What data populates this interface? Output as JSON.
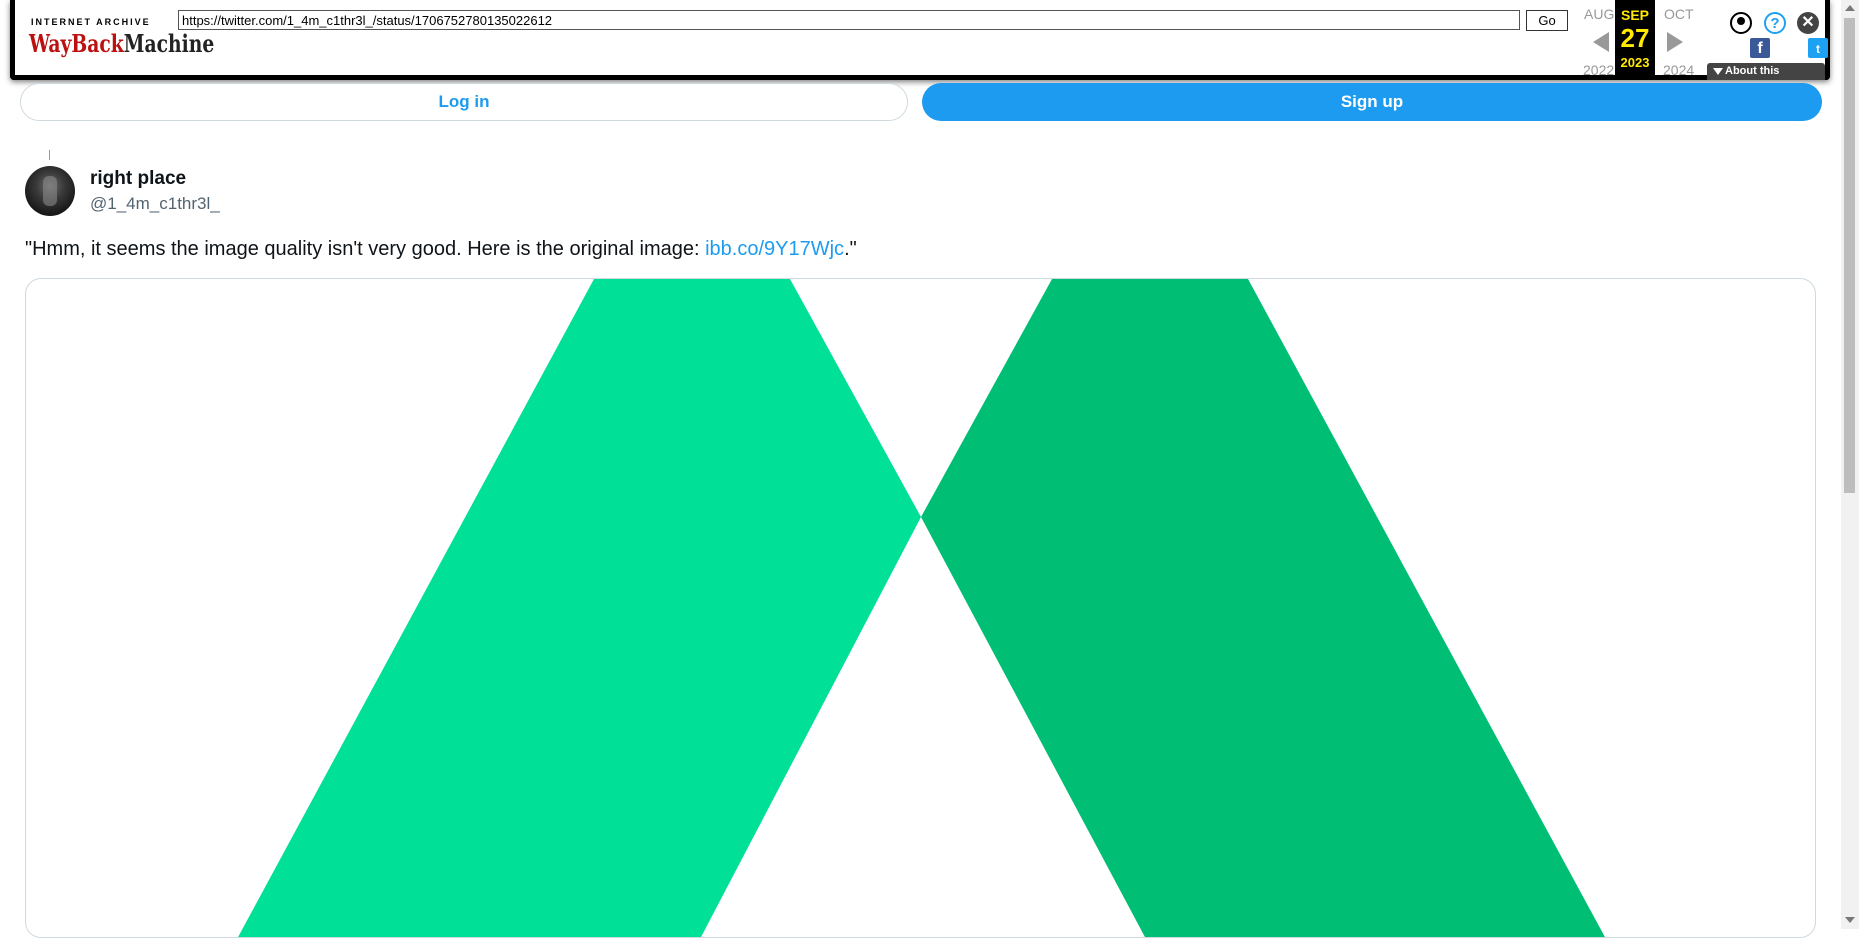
{
  "wayback": {
    "logo_top": "INTERNET ARCHIVE",
    "logo_way": "WayBack",
    "logo_machine": "Machine",
    "url": "https://twitter.com/1_4m_c1thr3l_/status/1706752780135022612",
    "go_label": "Go",
    "prev_month": "AUG",
    "prev_year": "2022",
    "cur_month": "SEP",
    "cur_day": "27",
    "cur_year": "2023",
    "next_month": "OCT",
    "next_year": "2024",
    "help_glyph": "?",
    "close_glyph": "✕",
    "facebook_glyph": "f",
    "twitter_glyph": "t",
    "about_label": "About this capture",
    "icons": [
      "user-icon",
      "help-icon",
      "close-icon",
      "facebook-icon",
      "twitter-icon"
    ]
  },
  "auth": {
    "login_label": "Log in",
    "signup_label": "Sign up"
  },
  "tweet": {
    "display_name": "right place",
    "handle": "@1_4m_c1thr3l_",
    "text_before": "\"Hmm, it seems the image quality isn't very good. Here is the original image: ",
    "link_text": "ibb.co/9Y17Wjc",
    "text_after": ".\""
  },
  "colors": {
    "accent": "#1d9bf0",
    "logo_green_light": "#00e096",
    "logo_green_dark": "#00bf74",
    "wayback_yellow": "#ffea00"
  }
}
